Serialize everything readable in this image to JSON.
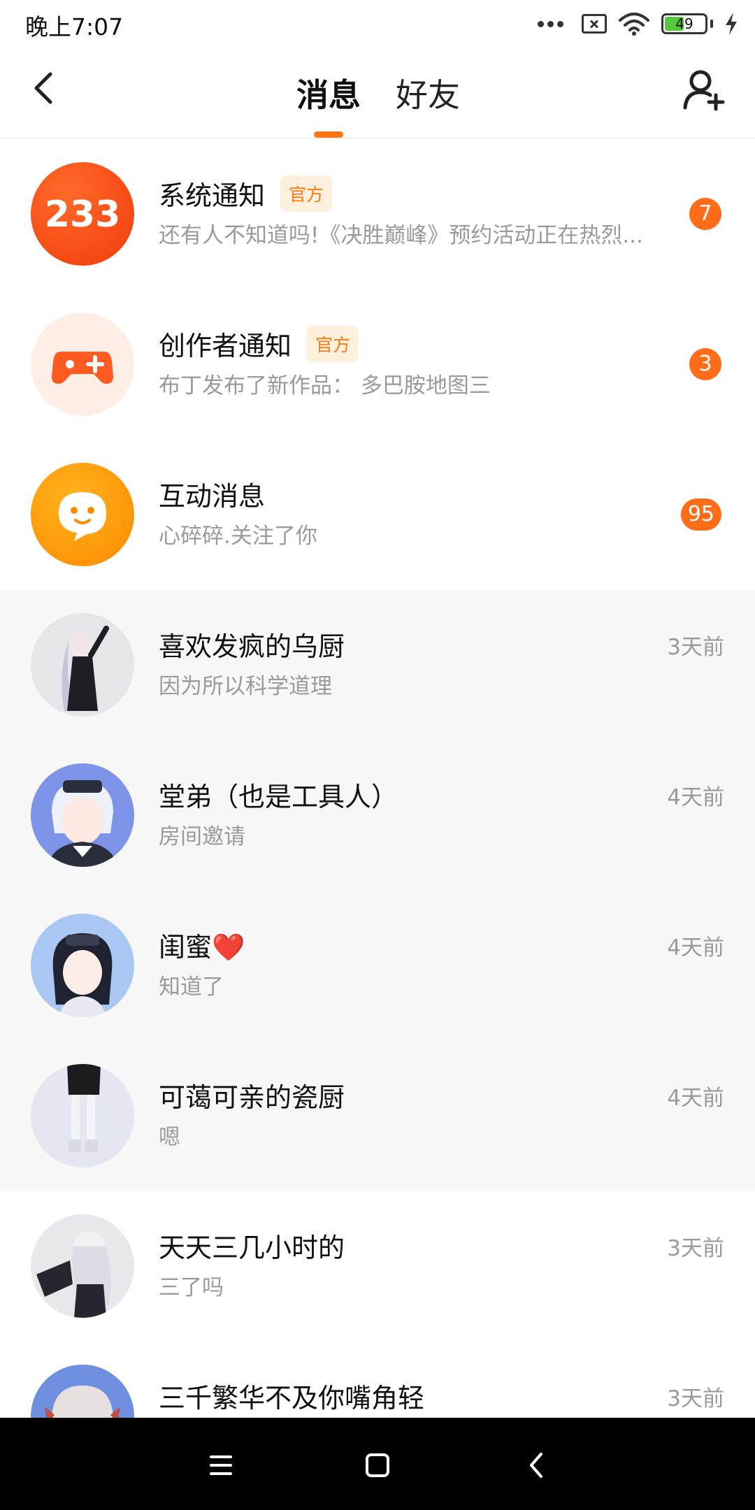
{
  "status_bar": {
    "time": "晚上7:07",
    "battery": "49",
    "icons": [
      "more-dots-icon",
      "no-sim-icon",
      "wifi-icon",
      "battery-icon",
      "charging-icon"
    ]
  },
  "header": {
    "tabs": [
      {
        "label": "消息",
        "active": true
      },
      {
        "label": "好友",
        "active": false
      }
    ],
    "accent_color": "#ff7510"
  },
  "messages": [
    {
      "name": "系统通知",
      "badge": "官方",
      "preview": "还有人不知道吗!《决胜巅峰》预约活动正在热烈...",
      "count": "7",
      "avatar": "233-logo"
    },
    {
      "name": "创作者通知",
      "badge": "官方",
      "preview": "布丁发布了新作品：  多巴胺地图三",
      "count": "3",
      "avatar": "gamepad-icon"
    },
    {
      "name": "互动消息",
      "preview": "心碎碎.关注了你",
      "count": "95",
      "avatar": "chat-bubble-icon"
    },
    {
      "name": "喜欢发疯的乌厨",
      "preview": "因为所以科学道理",
      "time": "3天前"
    },
    {
      "name": "堂弟（也是工具人）",
      "preview": "房间邀请",
      "time": "4天前"
    },
    {
      "name": "闺蜜❤️",
      "preview": "知道了",
      "time": "4天前"
    },
    {
      "name": "可蔼可亲的瓷厨",
      "preview": "嗯",
      "time": "4天前"
    },
    {
      "name": "天天三几小时的",
      "preview": "三了吗",
      "time": "3天前"
    },
    {
      "name": "三千繁华不及你嘴角轻",
      "preview": "",
      "time": "3天前"
    }
  ],
  "nav_bar": {
    "icons": [
      "menu-icon",
      "home-icon",
      "back-icon"
    ]
  }
}
